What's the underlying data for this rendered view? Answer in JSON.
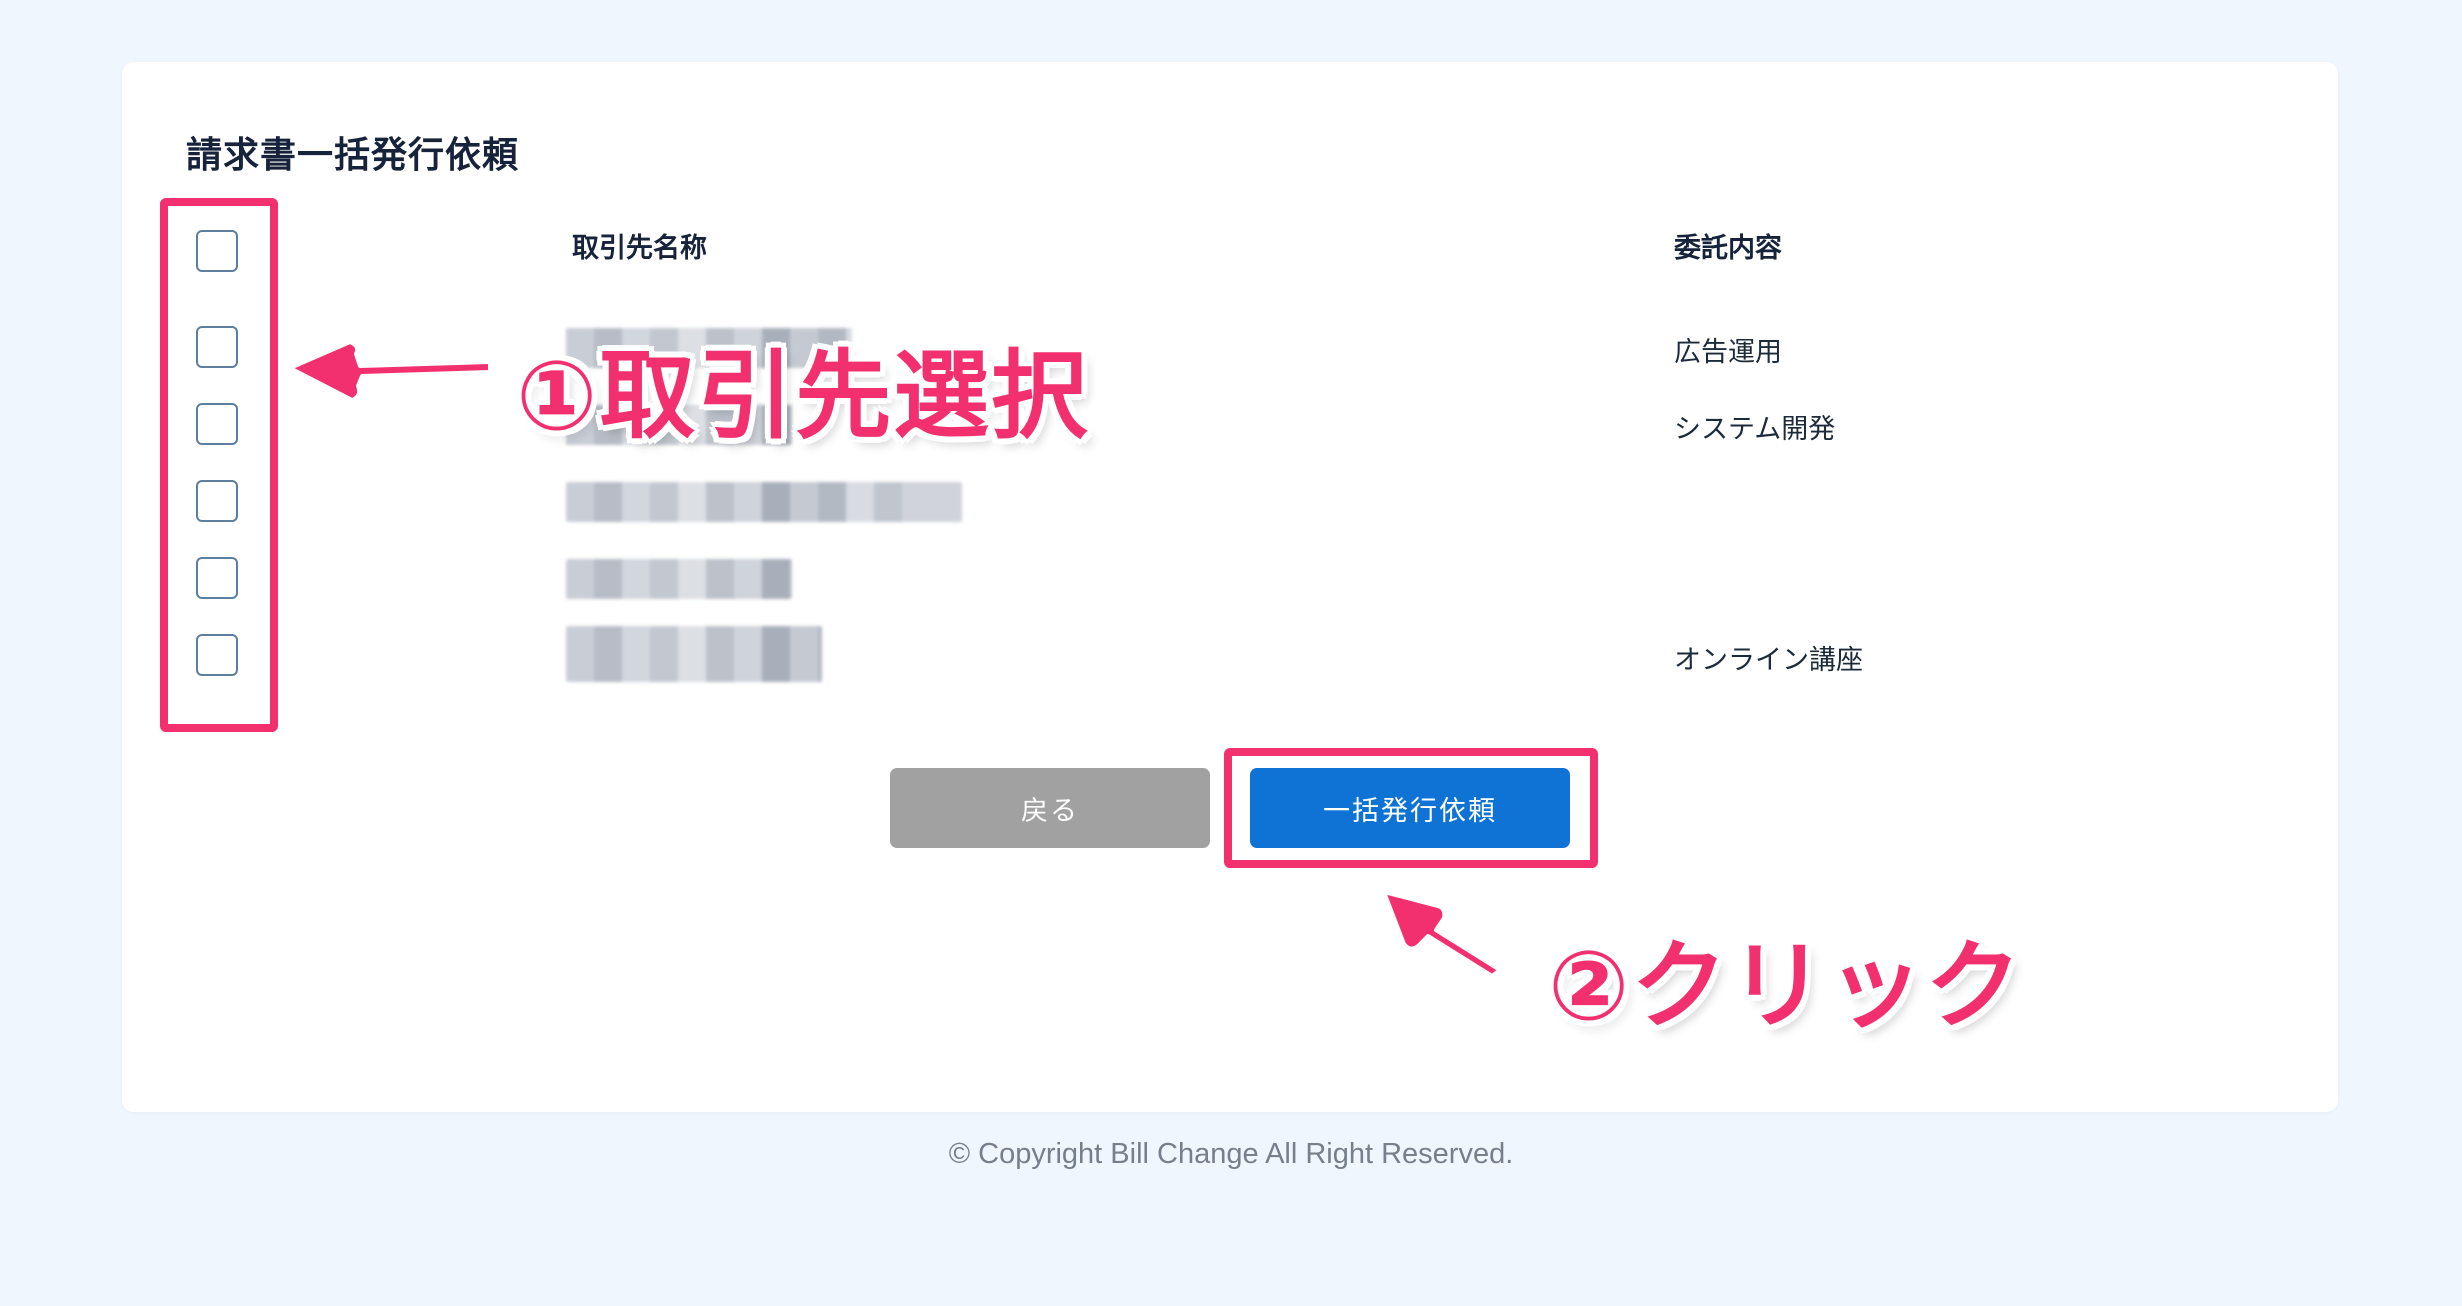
{
  "page": {
    "title": "請求書一括発行依頼"
  },
  "table": {
    "headers": {
      "client_name": "取引先名称",
      "content": "委託内容"
    },
    "rows": [
      {
        "client_name": "",
        "content": ""
      },
      {
        "client_name": "",
        "content": "広告運用"
      },
      {
        "client_name": "",
        "content": "システム開発"
      },
      {
        "client_name": "",
        "content": ""
      },
      {
        "client_name": "",
        "content": ""
      },
      {
        "client_name": "",
        "content": "オンライン講座"
      }
    ]
  },
  "buttons": {
    "back_label": "戻る",
    "bulk_issue_label": "一括発行依頼"
  },
  "annotations": {
    "select_client": "①取引先選択",
    "click": "②クリック"
  },
  "footer": {
    "copyright": "© Copyright Bill Change All Right Reserved."
  },
  "colors": {
    "background": "#f0f6fd",
    "primary_button": "#0f73d6",
    "back_button": "#a1a1a1",
    "annotation_accent": "#f2306f"
  }
}
